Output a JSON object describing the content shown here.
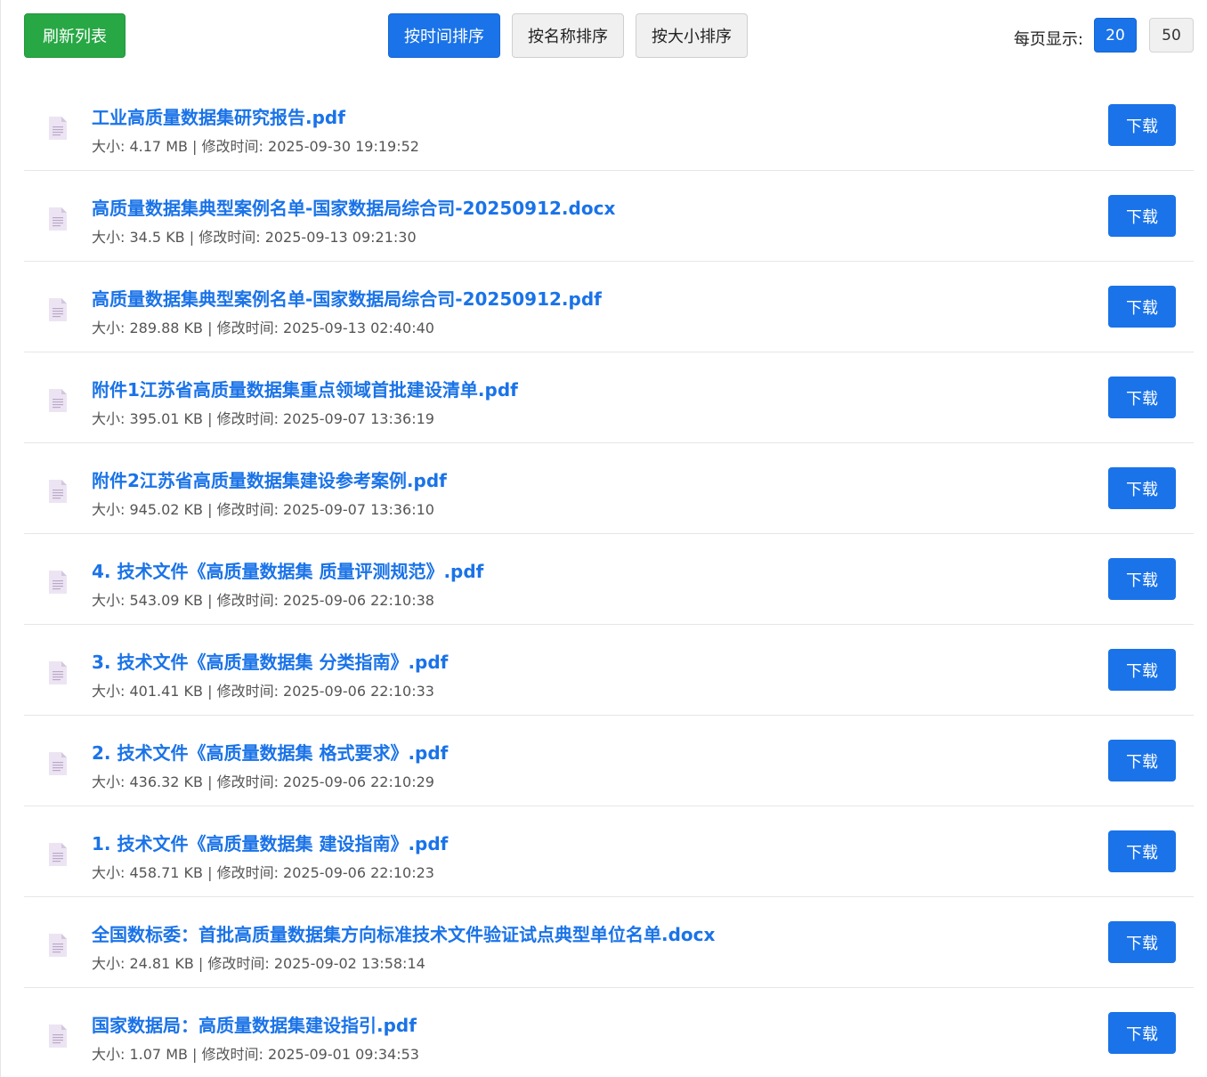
{
  "toolbar": {
    "refresh_label": "刷新列表",
    "sort_buttons": [
      {
        "label": "按时间排序",
        "active": true
      },
      {
        "label": "按名称排序",
        "active": false
      },
      {
        "label": "按大小排序",
        "active": false
      }
    ],
    "per_page_label": "每页显示:",
    "per_page_options": [
      {
        "label": "20",
        "active": true
      },
      {
        "label": "50",
        "active": false
      }
    ]
  },
  "colors": {
    "accent": "#1a73e8",
    "refresh_green": "#28a745",
    "icon_fill": "#ede4f3",
    "icon_lines": "#b9a9c9"
  },
  "file_icon_name": "document-icon",
  "download_label": "下载",
  "files": [
    {
      "name": "工业高质量数据集研究报告.pdf",
      "meta": "大小: 4.17 MB | 修改时间: 2025-09-30 19:19:52"
    },
    {
      "name": "高质量数据集典型案例名单-国家数据局综合司-20250912.docx",
      "meta": "大小: 34.5 KB | 修改时间: 2025-09-13 09:21:30"
    },
    {
      "name": "高质量数据集典型案例名单-国家数据局综合司-20250912.pdf",
      "meta": "大小: 289.88 KB | 修改时间: 2025-09-13 02:40:40"
    },
    {
      "name": "附件1江苏省高质量数据集重点领域首批建设清单.pdf",
      "meta": "大小: 395.01 KB | 修改时间: 2025-09-07 13:36:19"
    },
    {
      "name": "附件2江苏省高质量数据集建设参考案例.pdf",
      "meta": "大小: 945.02 KB | 修改时间: 2025-09-07 13:36:10"
    },
    {
      "name": "4. 技术文件《高质量数据集 质量评测规范》.pdf",
      "meta": "大小: 543.09 KB | 修改时间: 2025-09-06 22:10:38"
    },
    {
      "name": "3. 技术文件《高质量数据集 分类指南》.pdf",
      "meta": "大小: 401.41 KB | 修改时间: 2025-09-06 22:10:33"
    },
    {
      "name": "2. 技术文件《高质量数据集 格式要求》.pdf",
      "meta": "大小: 436.32 KB | 修改时间: 2025-09-06 22:10:29"
    },
    {
      "name": "1. 技术文件《高质量数据集 建设指南》.pdf",
      "meta": "大小: 458.71 KB | 修改时间: 2025-09-06 22:10:23"
    },
    {
      "name": "全国数标委：首批高质量数据集方向标准技术文件验证试点典型单位名单.docx",
      "meta": "大小: 24.81 KB | 修改时间: 2025-09-02 13:58:14"
    },
    {
      "name": "国家数据局：高质量数据集建设指引.pdf",
      "meta": "大小: 1.07 MB | 修改时间: 2025-09-01 09:34:53"
    }
  ]
}
